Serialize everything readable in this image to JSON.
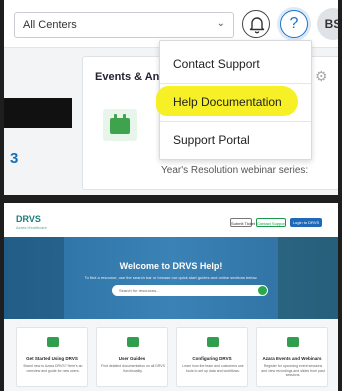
{
  "header": {
    "center_select": {
      "value": "All Centers"
    },
    "avatar_initials": "BS"
  },
  "dashboard": {
    "events_card_title": "Events & An",
    "stat_number": "3",
    "card_snippet": "Year's Resolution webinar series:"
  },
  "help_menu": {
    "items": [
      {
        "label": "Contact Support"
      },
      {
        "label": "Help Documentation",
        "highlighted": true
      },
      {
        "label": "Support Portal"
      }
    ],
    "highlight_color": "#f7ef1a"
  },
  "help_site": {
    "logo": "DRVS",
    "logo_tagline": "Azara Healthcare",
    "nav_buttons": [
      "Submit Ticket",
      "Contact Support",
      "Login to DRVS"
    ],
    "hero": {
      "title": "Welcome to DRVS Help!",
      "subtitle": "To find a resource, use the search bar or browse our quick start guides and online sections below.",
      "search_placeholder": "Search for resources..."
    },
    "tiles": [
      {
        "title": "Get Started Using DRVS",
        "desc": "Brand new to Azara DRVS? Here's an overview and guide for new users."
      },
      {
        "title": "User Guides",
        "desc": "Find detailed documentation on all DRVS functionality."
      },
      {
        "title": "Configuring DRVS",
        "desc": "Learn how the team and customers use tools to set up data and workflows."
      },
      {
        "title": "Azara Events and Webinars",
        "desc": "Register for upcoming event sessions and view recordings and slides from past sessions."
      }
    ]
  },
  "colors": {
    "accent_blue": "#1a73c8",
    "green": "#3fa34d",
    "hero_blue": "#3b82b6"
  }
}
